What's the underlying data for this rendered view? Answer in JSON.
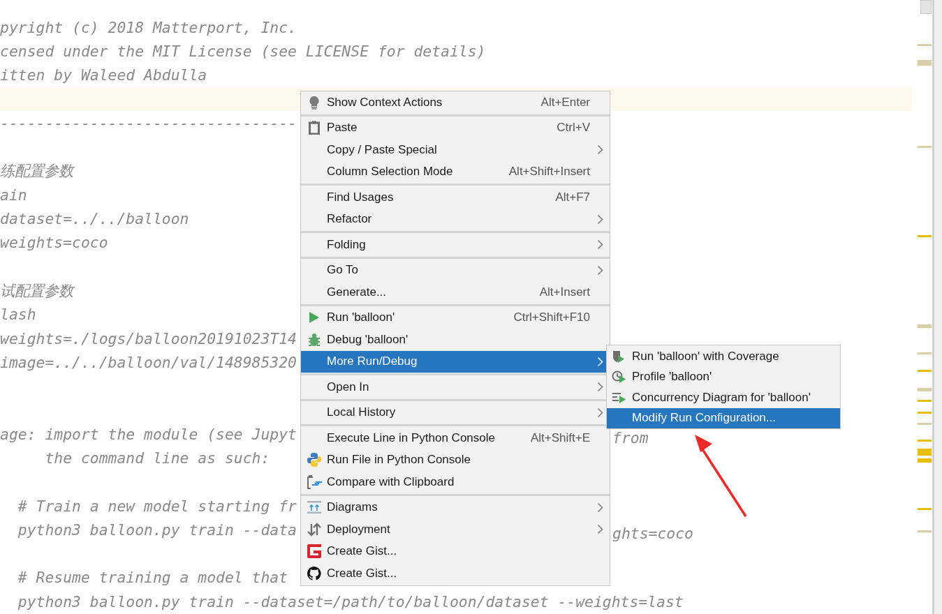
{
  "editor": {
    "lines": [
      {
        "text": "pyright (c) 2018 Matterport, Inc.",
        "current": false
      },
      {
        "text": "censed under the MIT License (see LICENSE for details)",
        "current": false
      },
      {
        "text": "itten by Waleed Abdulla",
        "current": false
      },
      {
        "current": true
      },
      {
        "text": "---------------------------------",
        "current": false
      },
      {
        "current": false
      },
      {
        "text": "练配置参数",
        "current": false
      },
      {
        "text": "ain",
        "current": false
      },
      {
        "text": "dataset=../../balloon",
        "current": false
      },
      {
        "text": "weights=coco",
        "current": false
      },
      {
        "current": false
      },
      {
        "text": "试配置参数",
        "current": false
      },
      {
        "text": "lash",
        "current": false
      },
      {
        "text": "weights=./logs/balloon20191023T14",
        "current": false
      },
      {
        "text": "image=../../balloon/val/148985320",
        "current": false
      },
      {
        "current": false
      },
      {
        "current": false
      },
      {
        "text": "age: import the module (see Jupyt",
        "right": "from",
        "current": false
      },
      {
        "text": "     the command line as such:",
        "current": false
      },
      {
        "current": false
      },
      {
        "text": "  # Train a new model starting fr",
        "current": false
      },
      {
        "text": "  python3 balloon.py train --data",
        "right": "ghts=coco",
        "current": false
      },
      {
        "current": false
      },
      {
        "text": "  # Resume training a model that",
        "current": false
      },
      {
        "text": "  python3 balloon.py train --dataset=/path/to/balloon/dataset --weights=last",
        "current": false
      }
    ]
  },
  "context_menu": {
    "groups": [
      [
        {
          "label": "Show Context Actions",
          "shortcut": "Alt+Enter",
          "submenu": false,
          "selected": false
        }
      ],
      [
        {
          "label": "Paste",
          "shortcut": "Ctrl+V",
          "submenu": false,
          "selected": false
        },
        {
          "label": "Copy / Paste Special",
          "submenu": true,
          "selected": false
        },
        {
          "label": "Column Selection Mode",
          "shortcut": "Alt+Shift+Insert",
          "submenu": false,
          "selected": false
        }
      ],
      [
        {
          "label": "Find Usages",
          "shortcut": "Alt+F7",
          "submenu": false,
          "selected": false
        },
        {
          "label": "Refactor",
          "submenu": true,
          "selected": false
        }
      ],
      [
        {
          "label": "Folding",
          "submenu": true,
          "selected": false
        }
      ],
      [
        {
          "label": "Go To",
          "submenu": true,
          "selected": false
        },
        {
          "label": "Generate...",
          "shortcut": "Alt+Insert",
          "submenu": false,
          "selected": false
        }
      ],
      [
        {
          "label": "Run 'balloon'",
          "shortcut": "Ctrl+Shift+F10",
          "submenu": false,
          "selected": false
        },
        {
          "label": "Debug 'balloon'",
          "submenu": false,
          "selected": false
        },
        {
          "label": "More Run/Debug",
          "submenu": true,
          "selected": true
        }
      ],
      [
        {
          "label": "Open In",
          "submenu": true,
          "selected": false
        }
      ],
      [
        {
          "label": "Local History",
          "submenu": true,
          "selected": false
        }
      ],
      [
        {
          "label": "Execute Line in Python Console",
          "shortcut": "Alt+Shift+E",
          "submenu": false,
          "selected": false
        },
        {
          "label": "Run File in Python Console",
          "submenu": false,
          "selected": false
        },
        {
          "label": "Compare with Clipboard",
          "submenu": false,
          "selected": false
        }
      ],
      [
        {
          "label": "Diagrams",
          "submenu": true,
          "selected": false
        },
        {
          "label": "Deployment",
          "submenu": true,
          "selected": false
        },
        {
          "label": "Create Gist...",
          "submenu": false,
          "selected": false
        },
        {
          "label": "Create Gist...",
          "submenu": false,
          "selected": false
        }
      ]
    ]
  },
  "submenu": {
    "items": [
      {
        "label": "Run 'balloon' with Coverage",
        "selected": false
      },
      {
        "label": "Profile 'balloon'",
        "selected": false
      },
      {
        "label": "Concurrency Diagram for 'balloon'",
        "selected": false
      },
      {
        "label": "Modify Run Configuration...",
        "selected": true
      }
    ]
  }
}
